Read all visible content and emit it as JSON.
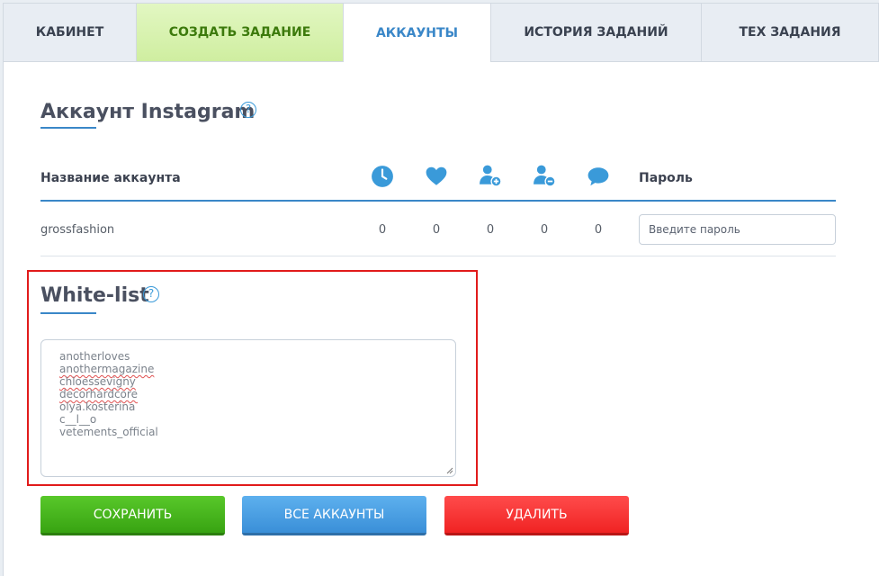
{
  "tabs": [
    {
      "label": "КАБИНЕТ"
    },
    {
      "label": "СОЗДАТЬ ЗАДАНИЕ"
    },
    {
      "label": "АККАУНТЫ"
    },
    {
      "label": "ИСТОРИЯ ЗАДАНИЙ"
    },
    {
      "label": "ТЕХ ЗАДАНИЯ"
    }
  ],
  "account_section": {
    "title": "Аккаунт Instagram",
    "help_glyph": "?",
    "columns": {
      "name": "Название аккаунта",
      "icons": [
        "clock-icon",
        "heart-icon",
        "user-add-icon",
        "user-remove-icon",
        "comment-icon"
      ],
      "password": "Пароль"
    },
    "rows": [
      {
        "name": "grossfashion",
        "stats": [
          "0",
          "0",
          "0",
          "0",
          "0"
        ],
        "password_placeholder": "Введите пароль"
      }
    ]
  },
  "whitelist": {
    "title": "White-list",
    "help_glyph": "?",
    "entries": [
      "anotherloves",
      "anothermagazine",
      "chloessevigny",
      "decorhardcore",
      "olya.kosterina",
      "c__l__o",
      "vetements_official"
    ]
  },
  "buttons": {
    "save": "СОХРАНИТЬ",
    "all_accounts": "ВСЕ АККАУНТЫ",
    "delete": "УДАЛИТЬ"
  },
  "colors": {
    "accent": "#3a87c8",
    "icon": "#3a9ad9",
    "save": "#42b01c",
    "all": "#4aa0e4",
    "delete": "#f53333",
    "highlight_border": "#e11b1b"
  }
}
